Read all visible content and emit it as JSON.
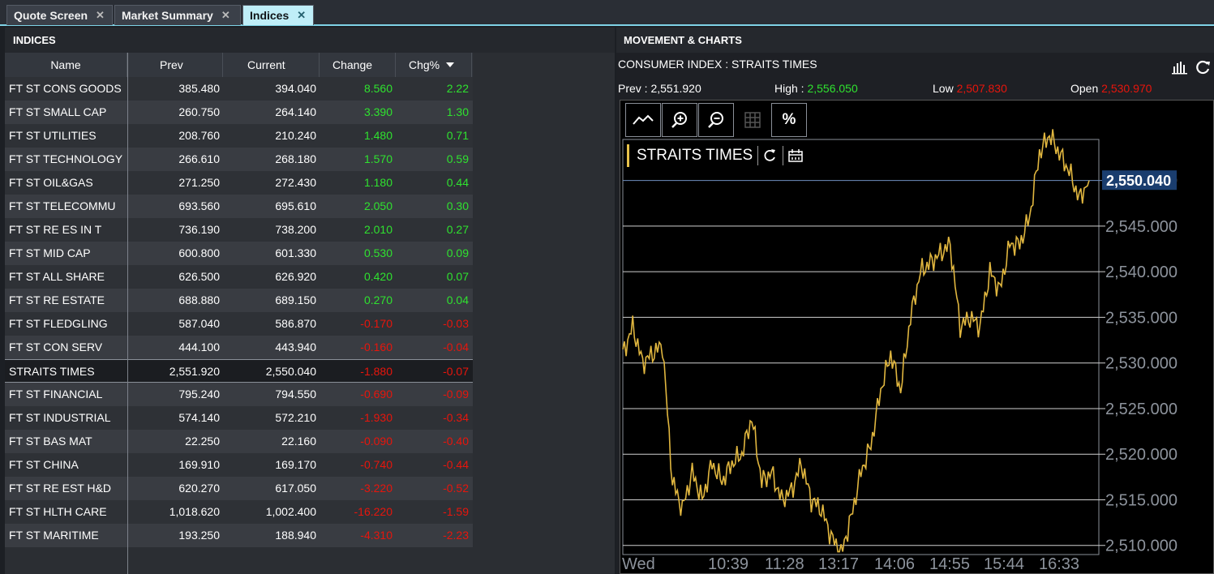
{
  "tabs": [
    {
      "label": "Quote Screen",
      "active": false
    },
    {
      "label": "Market Summary",
      "active": false
    },
    {
      "label": "Indices",
      "active": true
    }
  ],
  "left_panel": {
    "title": "INDICES",
    "columns": {
      "name": "Name",
      "prev": "Prev",
      "current": "Current",
      "change": "Change",
      "chg_pct": "Chg%"
    },
    "sort_icon": "caret-down-icon"
  },
  "rows": [
    {
      "name": "FT ST CONS GOODS",
      "prev": "385.480",
      "current": "394.040",
      "change": "8.560",
      "pct": "2.22",
      "dir": "up"
    },
    {
      "name": "FT ST SMALL CAP",
      "prev": "260.750",
      "current": "264.140",
      "change": "3.390",
      "pct": "1.30",
      "dir": "up"
    },
    {
      "name": "FT ST UTILITIES",
      "prev": "208.760",
      "current": "210.240",
      "change": "1.480",
      "pct": "0.71",
      "dir": "up"
    },
    {
      "name": "FT ST TECHNOLOGY",
      "prev": "266.610",
      "current": "268.180",
      "change": "1.570",
      "pct": "0.59",
      "dir": "up"
    },
    {
      "name": "FT ST OIL&GAS",
      "prev": "271.250",
      "current": "272.430",
      "change": "1.180",
      "pct": "0.44",
      "dir": "up"
    },
    {
      "name": "FT ST TELECOMMU",
      "prev": "693.560",
      "current": "695.610",
      "change": "2.050",
      "pct": "0.30",
      "dir": "up"
    },
    {
      "name": "FT ST RE ES IN T",
      "prev": "736.190",
      "current": "738.200",
      "change": "2.010",
      "pct": "0.27",
      "dir": "up"
    },
    {
      "name": "FT ST MID CAP",
      "prev": "600.800",
      "current": "601.330",
      "change": "0.530",
      "pct": "0.09",
      "dir": "up"
    },
    {
      "name": "FT ST ALL SHARE",
      "prev": "626.500",
      "current": "626.920",
      "change": "0.420",
      "pct": "0.07",
      "dir": "up"
    },
    {
      "name": "FT ST RE ESTATE",
      "prev": "688.880",
      "current": "689.150",
      "change": "0.270",
      "pct": "0.04",
      "dir": "up"
    },
    {
      "name": "FT ST FLEDGLING",
      "prev": "587.040",
      "current": "586.870",
      "change": "-0.170",
      "pct": "-0.03",
      "dir": "down"
    },
    {
      "name": "FT ST CON SERV",
      "prev": "444.100",
      "current": "443.940",
      "change": "-0.160",
      "pct": "-0.04",
      "dir": "down"
    },
    {
      "name": "STRAITS TIMES",
      "prev": "2,551.920",
      "current": "2,550.040",
      "change": "-1.880",
      "pct": "-0.07",
      "dir": "down",
      "selected": true
    },
    {
      "name": "FT ST FINANCIAL",
      "prev": "795.240",
      "current": "794.550",
      "change": "-0.690",
      "pct": "-0.09",
      "dir": "down"
    },
    {
      "name": "FT ST INDUSTRIAL",
      "prev": "574.140",
      "current": "572.210",
      "change": "-1.930",
      "pct": "-0.34",
      "dir": "down"
    },
    {
      "name": "FT ST BAS MAT",
      "prev": "22.250",
      "current": "22.160",
      "change": "-0.090",
      "pct": "-0.40",
      "dir": "down"
    },
    {
      "name": "FT ST CHINA",
      "prev": "169.910",
      "current": "169.170",
      "change": "-0.740",
      "pct": "-0.44",
      "dir": "down"
    },
    {
      "name": "FT ST RE EST H&D",
      "prev": "620.270",
      "current": "617.050",
      "change": "-3.220",
      "pct": "-0.52",
      "dir": "down"
    },
    {
      "name": "FT ST HLTH CARE",
      "prev": "1,018.620",
      "current": "1,002.400",
      "change": "-16.220",
      "pct": "-1.59",
      "dir": "down"
    },
    {
      "name": "FT ST MARITIME",
      "prev": "193.250",
      "current": "188.940",
      "change": "-4.310",
      "pct": "-2.23",
      "dir": "down"
    }
  ],
  "right_panel": {
    "title": "MOVEMENT & CHARTS",
    "subtitle": "CONSUMER INDEX : STRAITS TIMES",
    "prev_label": "Prev : ",
    "prev_value": "2,551.920",
    "high_label": "High : ",
    "high_value": "2,556.050",
    "low_label": "Low ",
    "low_value": "2,507.830",
    "open_label": "Open ",
    "open_value": "2,530.970",
    "header_icons": [
      "bar-chart-icon",
      "refresh-icon"
    ],
    "toolbar": [
      "line-chart-icon",
      "zoom-in-icon",
      "zoom-out-icon",
      "grid-icon",
      "percent-icon"
    ],
    "toolbar_percent_label": "%",
    "legend_label": "STRAITS TIMES",
    "legend_icons": [
      "reload-icon",
      "calendar-icon"
    ]
  },
  "chart_data": {
    "type": "line",
    "series": [
      {
        "name": "STRAITS TIMES",
        "color": "#e0b63f"
      }
    ],
    "last_value_label": "2,550.040",
    "last_value": 2550.04,
    "ylim": [
      2509.0,
      2554.5
    ],
    "y_ticks": [
      2510,
      2515,
      2520,
      2525,
      2530,
      2535,
      2540,
      2545,
      2550
    ],
    "y_tick_labels": [
      "2,510.000",
      "2,515.000",
      "2,520.000",
      "2,525.000",
      "2,530.000",
      "2,535.000",
      "2,540.000",
      "2,545.000",
      "2,550.000"
    ],
    "x_ticks": [
      "Wed",
      "10:39",
      "11:28",
      "13:17",
      "14:06",
      "14:55",
      "15:44",
      "16:33"
    ],
    "x": [
      "09:00",
      "09:10",
      "09:20",
      "09:30",
      "09:40",
      "09:50",
      "10:00",
      "10:10",
      "10:20",
      "10:30",
      "10:39",
      "10:50",
      "11:00",
      "11:10",
      "11:20",
      "11:28",
      "11:40",
      "11:50",
      "12:00",
      "12:10",
      "12:20",
      "12:30",
      "12:40",
      "12:50",
      "13:00",
      "13:17",
      "13:30",
      "13:40",
      "13:50",
      "14:06",
      "14:15",
      "14:25",
      "14:35",
      "14:45",
      "14:55",
      "15:05",
      "15:15",
      "15:25",
      "15:35",
      "15:44",
      "15:55",
      "16:05",
      "16:15",
      "16:25",
      "16:33",
      "16:40",
      "16:45",
      "16:50"
    ],
    "values": [
      2531,
      2534,
      2530,
      2531,
      2532,
      2517,
      2514,
      2518,
      2515,
      2519,
      2517,
      2519,
      2520,
      2524,
      2517,
      2518,
      2515,
      2516,
      2519,
      2515,
      2514,
      2511,
      2509,
      2513,
      2518,
      2521,
      2527,
      2531,
      2527,
      2535,
      2540,
      2541,
      2542,
      2543,
      2534,
      2535,
      2534,
      2540,
      2538,
      2543,
      2543,
      2546,
      2553,
      2555,
      2553,
      2551,
      2548,
      2550
    ]
  }
}
